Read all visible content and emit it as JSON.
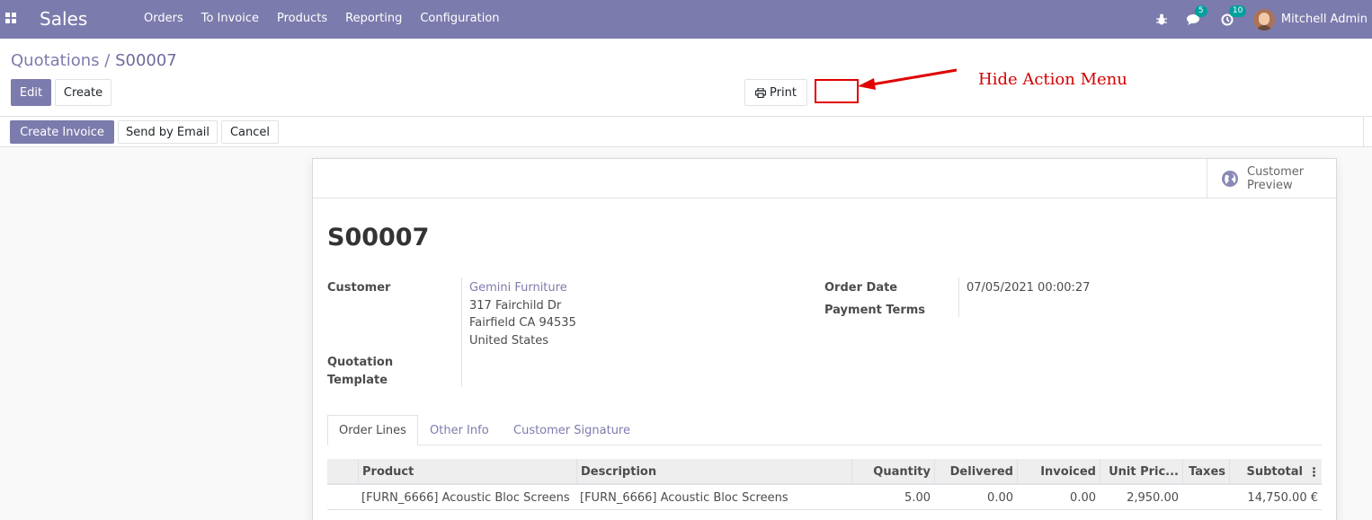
{
  "navbar": {
    "app_name": "Sales",
    "menu": [
      "Orders",
      "To Invoice",
      "Products",
      "Reporting",
      "Configuration"
    ],
    "messages_count": "5",
    "activities_count": "10",
    "user_name": "Mitchell Admin"
  },
  "breadcrumb": {
    "parent": "Quotations",
    "separator": " / ",
    "current": "S00007"
  },
  "control_panel": {
    "edit_label": "Edit",
    "create_label": "Create",
    "print_label": "Print"
  },
  "annotation": {
    "text": "Hide Action Menu"
  },
  "statusbar": {
    "create_invoice_label": "Create Invoice",
    "send_email_label": "Send by Email",
    "cancel_label": "Cancel"
  },
  "smart_button": {
    "line1": "Customer",
    "line2": "Preview"
  },
  "form": {
    "name": "S00007",
    "customer_label": "Customer",
    "customer_name": "Gemini Furniture",
    "address_line1": "317 Fairchild Dr",
    "address_line2": "Fairfield CA 94535",
    "address_line3": "United States",
    "quotation_template_label_1": "Quotation",
    "quotation_template_label_2": "Template",
    "order_date_label": "Order Date",
    "order_date_value": "07/05/2021 00:00:27",
    "payment_terms_label": "Payment Terms"
  },
  "tabs": [
    "Order Lines",
    "Other Info",
    "Customer Signature"
  ],
  "table": {
    "headers": [
      "Product",
      "Description",
      "Quantity",
      "Delivered",
      "Invoiced",
      "Unit Pric...",
      "Taxes",
      "Subtotal"
    ],
    "rows": [
      {
        "product": "[FURN_6666] Acoustic Bloc Screens",
        "description": "[FURN_6666] Acoustic Bloc Screens",
        "quantity": "5.00",
        "delivered": "0.00",
        "invoiced": "0.00",
        "unit_price": "2,950.00",
        "taxes": "",
        "subtotal": "14,750.00 €"
      }
    ]
  }
}
